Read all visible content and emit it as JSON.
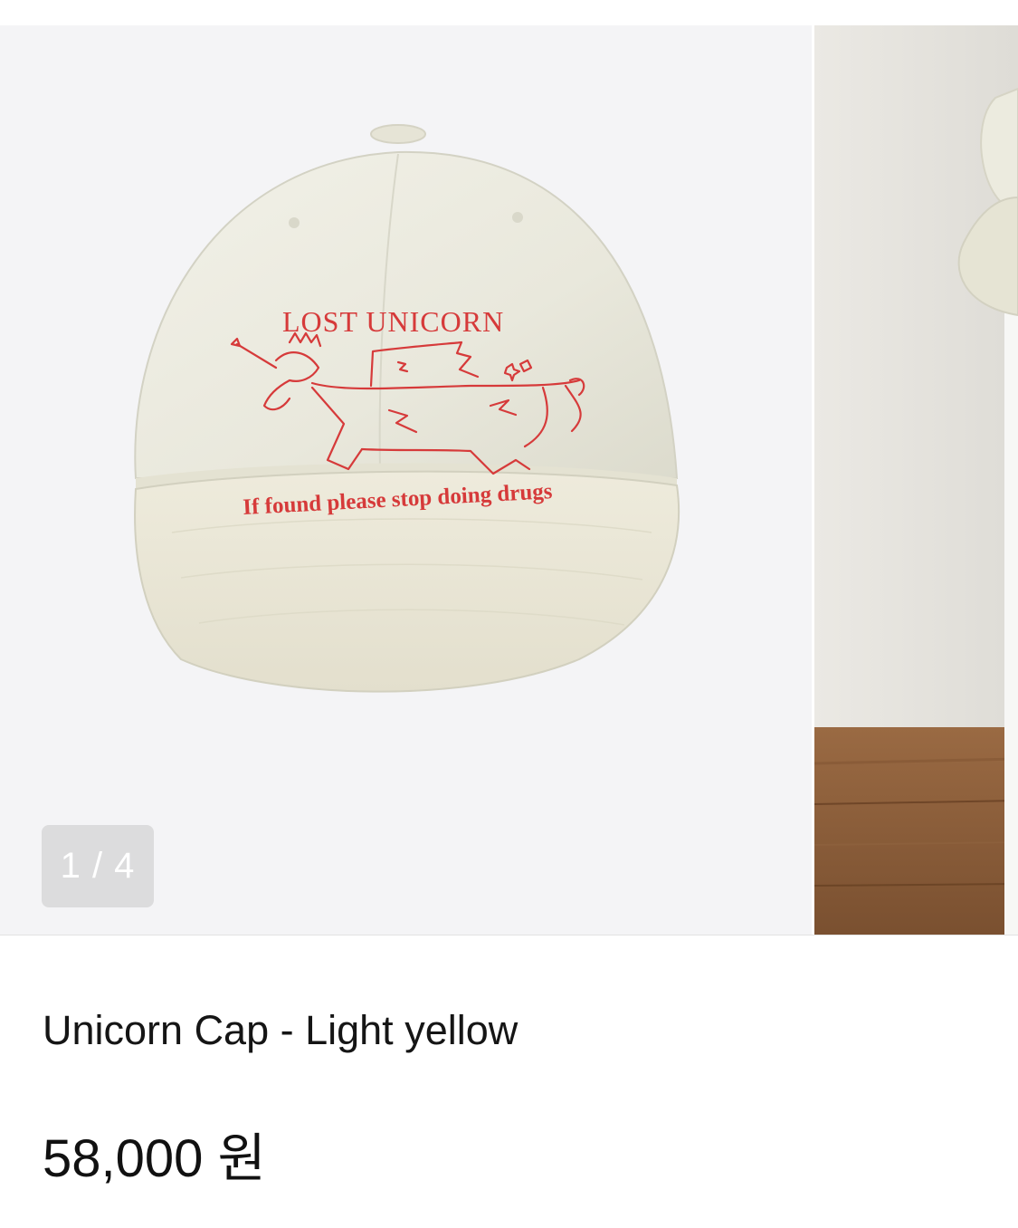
{
  "gallery": {
    "counter": "1 / 4",
    "current_image": 1,
    "total_images": 4,
    "cap_text": {
      "brand": "LOST UNICORN",
      "tagline": "If found please stop doing drugs"
    }
  },
  "product": {
    "name": "Unicorn Cap - Light yellow",
    "price": "58,000 원"
  },
  "colors": {
    "embroidery": "#d63a3a",
    "cap": "#efeee3",
    "background": "#f4f4f6"
  }
}
